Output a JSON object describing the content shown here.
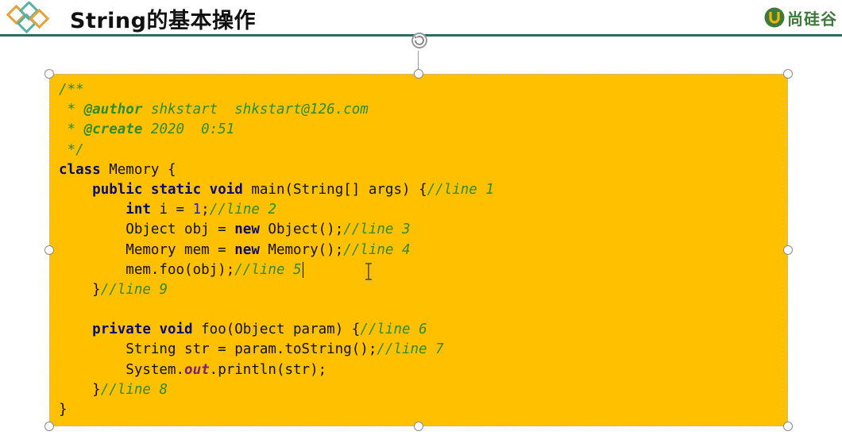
{
  "header": {
    "title": "String的基本操作",
    "brand": "尚硅谷"
  },
  "code_lines": [
    [
      {
        "t": "/**",
        "c": "cm"
      }
    ],
    [
      {
        "t": " * ",
        "c": "cm"
      },
      {
        "t": "@author",
        "c": "cmb"
      },
      {
        "t": " shkstart  shkstart@126.com",
        "c": "cm"
      }
    ],
    [
      {
        "t": " * ",
        "c": "cm"
      },
      {
        "t": "@create",
        "c": "cmb"
      },
      {
        "t": " 2020  0:51",
        "c": "cm"
      }
    ],
    [
      {
        "t": " */",
        "c": "cm"
      }
    ],
    [
      {
        "t": "class",
        "c": "kw"
      },
      {
        "t": " Memory {",
        "c": ""
      }
    ],
    [
      {
        "t": "    ",
        "c": ""
      },
      {
        "t": "public static void",
        "c": "kw"
      },
      {
        "t": " main(String[] args) {",
        "c": ""
      },
      {
        "t": "//line 1",
        "c": "cm"
      }
    ],
    [
      {
        "t": "        ",
        "c": ""
      },
      {
        "t": "int",
        "c": "kw"
      },
      {
        "t": " i = ",
        "c": ""
      },
      {
        "t": "1",
        "c": "num"
      },
      {
        "t": ";",
        "c": ""
      },
      {
        "t": "//line 2",
        "c": "cm"
      }
    ],
    [
      {
        "t": "        Object obj = ",
        "c": ""
      },
      {
        "t": "new",
        "c": "kw"
      },
      {
        "t": " Object();",
        "c": ""
      },
      {
        "t": "//line 3",
        "c": "cm"
      }
    ],
    [
      {
        "t": "        Memory mem = ",
        "c": ""
      },
      {
        "t": "new",
        "c": "kw"
      },
      {
        "t": " Memory();",
        "c": ""
      },
      {
        "t": "//line 4",
        "c": "cm"
      }
    ],
    [
      {
        "t": "        mem.foo(obj);",
        "c": ""
      },
      {
        "t": "//line 5",
        "c": "cm"
      },
      {
        "t": "",
        "c": "caret"
      }
    ],
    [
      {
        "t": "    }",
        "c": ""
      },
      {
        "t": "//line 9",
        "c": "cm"
      }
    ],
    [
      {
        "t": "",
        "c": ""
      }
    ],
    [
      {
        "t": "    ",
        "c": ""
      },
      {
        "t": "private void",
        "c": "kw"
      },
      {
        "t": " foo(Object param) {",
        "c": ""
      },
      {
        "t": "//line 6",
        "c": "cm"
      }
    ],
    [
      {
        "t": "        String str = param.toString();",
        "c": ""
      },
      {
        "t": "//line 7",
        "c": "cm"
      }
    ],
    [
      {
        "t": "        System.",
        "c": ""
      },
      {
        "t": "out",
        "c": "st"
      },
      {
        "t": ".println(str);",
        "c": ""
      }
    ],
    [
      {
        "t": "    }",
        "c": ""
      },
      {
        "t": "//line 8",
        "c": "cm"
      }
    ],
    [
      {
        "t": "}",
        "c": ""
      }
    ]
  ],
  "colors": {
    "code_background": "#ffc000",
    "header_rule": "#2f6b63",
    "keyword": "#0b0b6e",
    "comment": "#2e8b2e",
    "brand": "#3e7a3b"
  },
  "icons": [
    "slide-logo-icon",
    "brand-logo-icon",
    "rotate-handle-icon",
    "text-cursor-icon"
  ]
}
